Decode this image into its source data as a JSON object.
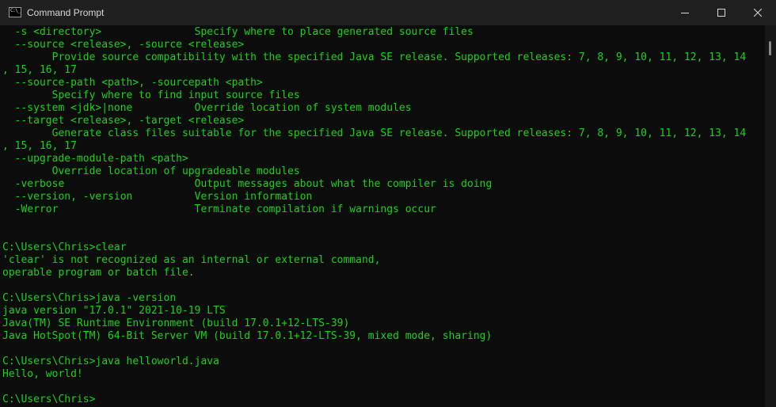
{
  "window": {
    "title": "Command Prompt",
    "icon_label": "C:\\_"
  },
  "icons": {
    "app": "command-prompt-icon",
    "minimize": "minimize-icon",
    "maximize": "maximize-icon",
    "close": "close-icon"
  },
  "colors": {
    "console_text": "#13d613",
    "background": "#0c0c0c",
    "titlebar": "#202020"
  },
  "console": {
    "lines": [
      "  -s <directory>               Specify where to place generated source files",
      "  --source <release>, -source <release>",
      "        Provide source compatibility with the specified Java SE release. Supported releases: 7, 8, 9, 10, 11, 12, 13, 14",
      ", 15, 16, 17",
      "  --source-path <path>, -sourcepath <path>",
      "        Specify where to find input source files",
      "  --system <jdk>|none          Override location of system modules",
      "  --target <release>, -target <release>",
      "        Generate class files suitable for the specified Java SE release. Supported releases: 7, 8, 9, 10, 11, 12, 13, 14",
      ", 15, 16, 17",
      "  --upgrade-module-path <path>",
      "        Override location of upgradeable modules",
      "  -verbose                     Output messages about what the compiler is doing",
      "  --version, -version          Version information",
      "  -Werror                      Terminate compilation if warnings occur",
      "",
      "",
      "C:\\Users\\Chris>clear",
      "'clear' is not recognized as an internal or external command,",
      "operable program or batch file.",
      "",
      "C:\\Users\\Chris>java -version",
      "java version \"17.0.1\" 2021-10-19 LTS",
      "Java(TM) SE Runtime Environment (build 17.0.1+12-LTS-39)",
      "Java HotSpot(TM) 64-Bit Server VM (build 17.0.1+12-LTS-39, mixed mode, sharing)",
      "",
      "C:\\Users\\Chris>java helloworld.java",
      "Hello, world!",
      "",
      "C:\\Users\\Chris>"
    ]
  }
}
